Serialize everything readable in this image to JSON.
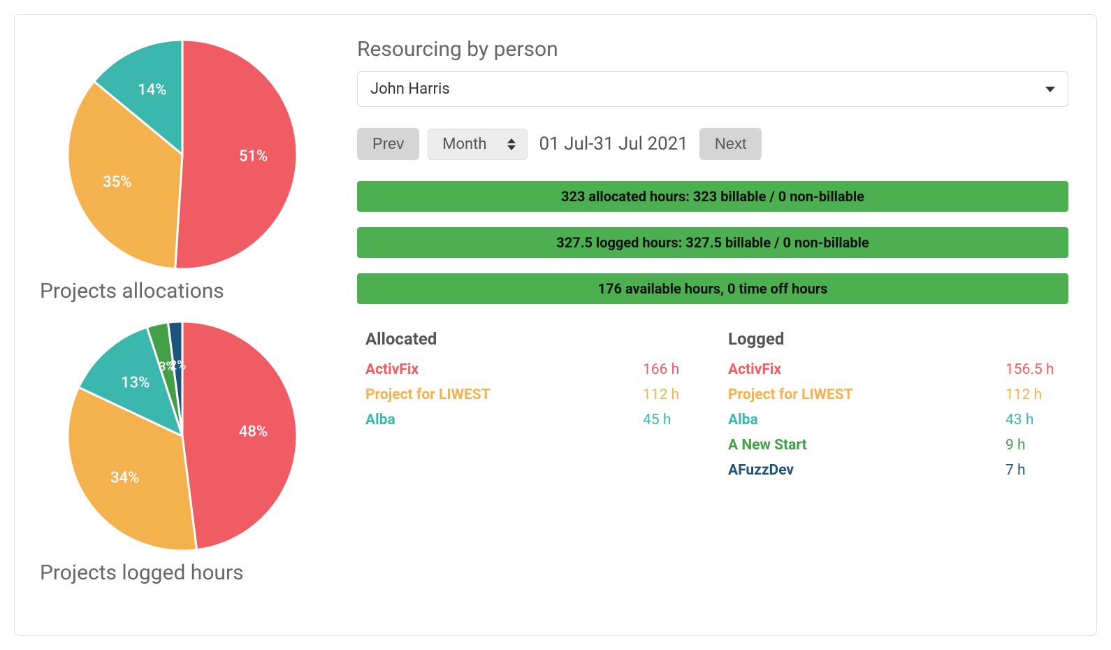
{
  "colors": {
    "red": "#f05c63",
    "orange": "#f3b24e",
    "teal": "#3bb7ae",
    "green": "#43a047",
    "navy": "#1e537d"
  },
  "left": {
    "chart1_title": "Projects allocations",
    "chart2_title": "Projects logged hours"
  },
  "header": {
    "title": "Resourcing by person",
    "person": "John Harris"
  },
  "dateNav": {
    "prev": "Prev",
    "period": "Month",
    "range": "01 Jul-31 Jul 2021",
    "next": "Next"
  },
  "bars": {
    "allocated": "323 allocated hours: 323 billable / 0 non-billable",
    "logged": "327.5 logged hours: 327.5 billable / 0 non-billable",
    "available": "176 available hours, 0 time off hours"
  },
  "tables": {
    "allocated_label": "Allocated",
    "logged_label": "Logged",
    "allocated": [
      {
        "name": "ActivFix",
        "hours": "166 h",
        "colorKey": "red"
      },
      {
        "name": "Project for LIWEST",
        "hours": "112 h",
        "colorKey": "orange"
      },
      {
        "name": "Alba",
        "hours": "45 h",
        "colorKey": "teal"
      }
    ],
    "logged": [
      {
        "name": "ActivFix",
        "hours": "156.5 h",
        "colorKey": "red"
      },
      {
        "name": "Project for LIWEST",
        "hours": "112 h",
        "colorKey": "orange"
      },
      {
        "name": "Alba",
        "hours": "43 h",
        "colorKey": "teal"
      },
      {
        "name": "A New Start",
        "hours": "9 h",
        "colorKey": "green"
      },
      {
        "name": "AFuzzDev",
        "hours": "7 h",
        "colorKey": "navy"
      }
    ]
  },
  "chart_data": [
    {
      "type": "pie",
      "title": "Projects allocations",
      "series": [
        {
          "name": "ActivFix",
          "value": 51,
          "pctLabel": "51%",
          "colorKey": "red"
        },
        {
          "name": "Project for LIWEST",
          "value": 35,
          "pctLabel": "35%",
          "colorKey": "orange"
        },
        {
          "name": "Alba",
          "value": 14,
          "pctLabel": "14%",
          "colorKey": "teal"
        }
      ]
    },
    {
      "type": "pie",
      "title": "Projects logged hours",
      "series": [
        {
          "name": "ActivFix",
          "value": 48,
          "pctLabel": "48%",
          "colorKey": "red"
        },
        {
          "name": "Project for LIWEST",
          "value": 34,
          "pctLabel": "34%",
          "colorKey": "orange"
        },
        {
          "name": "Alba",
          "value": 13,
          "pctLabel": "13%",
          "colorKey": "teal"
        },
        {
          "name": "A New Start",
          "value": 3,
          "pctLabel": "3%",
          "colorKey": "green"
        },
        {
          "name": "AFuzzDev",
          "value": 2,
          "pctLabel": "2%",
          "colorKey": "navy"
        }
      ]
    }
  ]
}
